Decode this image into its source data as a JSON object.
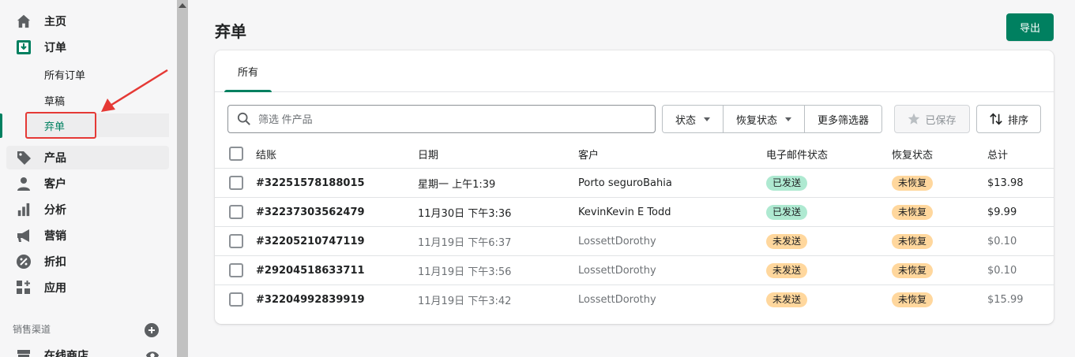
{
  "sidebar": {
    "nav": [
      {
        "label": "主页",
        "icon": "home-icon"
      },
      {
        "label": "订单",
        "icon": "orders-icon"
      }
    ],
    "sub_items": [
      {
        "label": "所有订单"
      },
      {
        "label": "草稿"
      },
      {
        "label": "弃单"
      }
    ],
    "nav2": [
      {
        "label": "产品",
        "icon": "tag-icon"
      },
      {
        "label": "客户",
        "icon": "person-icon"
      },
      {
        "label": "分析",
        "icon": "bar-chart-icon"
      },
      {
        "label": "营销",
        "icon": "megaphone-icon"
      },
      {
        "label": "折扣",
        "icon": "discount-icon"
      },
      {
        "label": "应用",
        "icon": "apps-icon"
      }
    ],
    "section_label": "销售渠道",
    "channel": {
      "label": "在线商店",
      "icon": "store-icon"
    }
  },
  "page": {
    "title": "弃单",
    "export_label": "导出"
  },
  "tabs": [
    {
      "label": "所有"
    }
  ],
  "search": {
    "placeholder": "筛选 件产品"
  },
  "filters": {
    "status": "状态",
    "recovery": "恢复状态",
    "more": "更多筛选器",
    "saved": "已保存",
    "sort": "排序"
  },
  "table": {
    "columns": [
      "结账",
      "日期",
      "客户",
      "电子邮件状态",
      "恢复状态",
      "总计"
    ],
    "rows": [
      {
        "order": "#32251578188015",
        "date": "星期一 上午1:39",
        "customer": "Porto seguroBahia",
        "email": "已发送",
        "recovery": "未恢复",
        "total": "$13.98"
      },
      {
        "order": "#32237303562479",
        "date": "11月30日 下午3:36",
        "customer": "KevinKevin E Todd",
        "email": "已发送",
        "recovery": "未恢复",
        "total": "$9.99"
      },
      {
        "order": "#32205210747119",
        "date": "11月19日 下午6:37",
        "customer": "LossettDorothy",
        "email": "未发送",
        "recovery": "未恢复",
        "total": "$0.10"
      },
      {
        "order": "#29204518633711",
        "date": "11月19日 下午3:56",
        "customer": "LossettDorothy",
        "email": "未发送",
        "recovery": "未恢复",
        "total": "$0.10"
      },
      {
        "order": "#32204992839919",
        "date": "11月19日 下午3:42",
        "customer": "LossettDorothy",
        "email": "未发送",
        "recovery": "未恢复",
        "total": "$15.99"
      }
    ]
  },
  "colors": {
    "accent": "#008060",
    "sent_badge": "#aee9d1",
    "unsent_badge": "#ffd79d",
    "annotation": "#e53935"
  }
}
